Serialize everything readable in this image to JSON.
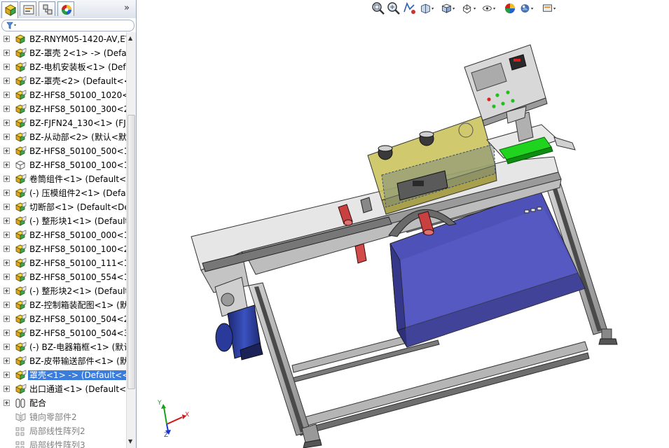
{
  "panel": {
    "tabs": [
      {
        "icon": "feature-manager-icon"
      },
      {
        "icon": "property-manager-icon"
      },
      {
        "icon": "configuration-manager-icon"
      },
      {
        "icon": "appearance-manager-icon"
      }
    ],
    "more_label": "»",
    "filter_icon": "filter-icon"
  },
  "tree": {
    "items": [
      {
        "label": "BZ-RNYM05-1420-AV,EY",
        "icon": "part-icon"
      },
      {
        "label": "BZ-罩壳 2<1> -> (Defau",
        "icon": "assembly-icon"
      },
      {
        "label": "BZ-电机安装板<1> (Defa",
        "icon": "assembly-icon"
      },
      {
        "label": "BZ-罩壳<2> (Default<<",
        "icon": "assembly-icon"
      },
      {
        "label": "BZ-HFS8_50100_1020<1",
        "icon": "assembly-icon"
      },
      {
        "label": "BZ-HFS8_50100_300<2>",
        "icon": "assembly-icon"
      },
      {
        "label": "BZ-FJFN24_130<1> (FJF",
        "icon": "assembly-icon"
      },
      {
        "label": "BZ-从动部<2> (默认<默",
        "icon": "assembly-icon"
      },
      {
        "label": "BZ-HFS8_50100_500<1>",
        "icon": "assembly-icon"
      },
      {
        "label": "BZ-HFS8_50100_100<1>",
        "icon": "part-outline-icon"
      },
      {
        "label": "卷筒组件<1> (Default<D",
        "icon": "assembly-icon"
      },
      {
        "label": "(-) 压模组件2<1> (Defau",
        "icon": "assembly-icon"
      },
      {
        "label": "切断部<1> (Default<Def",
        "icon": "assembly-icon"
      },
      {
        "label": "(-) 整形块1<1> (Default",
        "icon": "assembly-icon"
      },
      {
        "label": "BZ-HFS8_50100_000<1>",
        "icon": "assembly-icon"
      },
      {
        "label": "BZ-HFS8_50100_100<2>",
        "icon": "assembly-icon"
      },
      {
        "label": "BZ-HFS8_50100_111<1>",
        "icon": "assembly-icon"
      },
      {
        "label": "BZ-HFS8_50100_554<1>",
        "icon": "assembly-icon"
      },
      {
        "label": "(-) 整形块2<1> (Default",
        "icon": "assembly-icon"
      },
      {
        "label": "BZ-控制箱装配图<1> (默",
        "icon": "assembly-icon"
      },
      {
        "label": "BZ-HFS8_50100_504<2>",
        "icon": "assembly-icon"
      },
      {
        "label": "BZ-HFS8_50100_504<3>",
        "icon": "assembly-icon"
      },
      {
        "label": "(-) BZ-电器箱框<1> (默认",
        "icon": "assembly-icon"
      },
      {
        "label": "BZ-皮带输送部件<1> (默",
        "icon": "assembly-icon"
      },
      {
        "label": "罩壳<1> -> (Default<<D",
        "icon": "assembly-icon",
        "selected": true
      },
      {
        "label": "出口通道<1> (Default<<",
        "icon": "assembly-icon"
      },
      {
        "label": "配合",
        "icon": "mates-icon"
      },
      {
        "label": "镜向零部件2",
        "icon": "mirror-icon",
        "gray": true
      },
      {
        "label": "局部线性阵列2",
        "icon": "pattern-icon",
        "gray": true
      },
      {
        "label": "局部线性阵列3",
        "icon": "pattern-icon",
        "gray": true
      }
    ]
  },
  "hud": {
    "buttons": [
      {
        "name": "zoom-to-fit-icon"
      },
      {
        "name": "zoom-to-area-icon"
      },
      {
        "name": "previous-view-icon"
      },
      {
        "name": "section-view-icon"
      },
      {
        "name": "view-orientation-icon"
      },
      {
        "name": "display-style-icon"
      },
      {
        "name": "hide-show-items-icon"
      },
      {
        "name": "edit-appearance-icon"
      },
      {
        "name": "apply-scene-icon"
      },
      {
        "name": "view-settings-icon"
      }
    ]
  },
  "triad": {
    "x": "X",
    "y": "Y",
    "z": "Z"
  },
  "colors": {
    "selection": "#3b7ddd",
    "frame": "#bfbfbf",
    "cabinet": "#5a5fc8",
    "cover": "#c9c05a",
    "conveyor": "#1fd31f",
    "motor": "#2a3a9a"
  }
}
